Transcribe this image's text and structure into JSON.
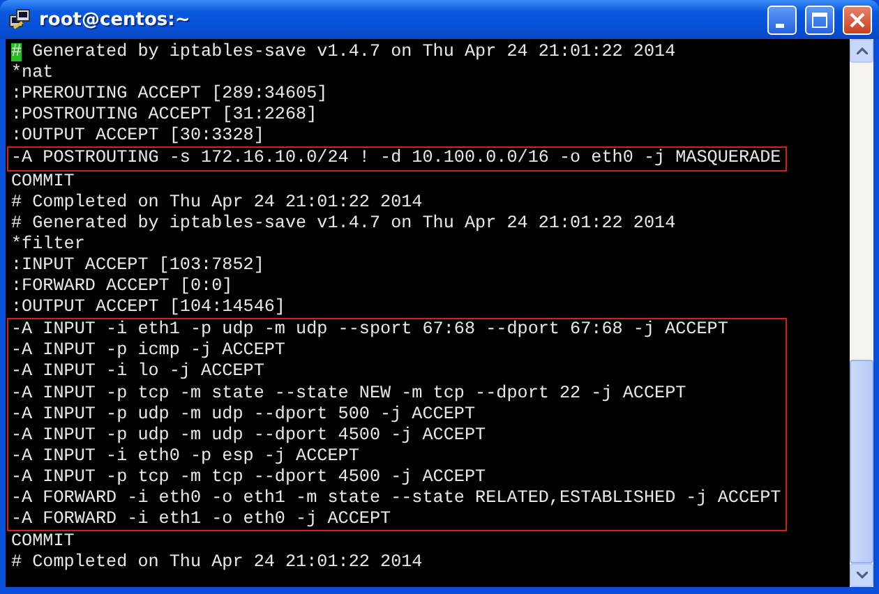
{
  "window": {
    "title": "root@centos:~"
  },
  "terminal": {
    "blocks": [
      {
        "highlighted": false,
        "lines": [
          {
            "text": "# Generated by iptables-save v1.4.7 on Thu Apr 24 21:01:22 2014",
            "cursor": true
          },
          {
            "text": "*nat",
            "cursor": false
          },
          {
            "text": ":PREROUTING ACCEPT [289:34605]",
            "cursor": false
          },
          {
            "text": ":POSTROUTING ACCEPT [31:2268]",
            "cursor": false
          },
          {
            "text": ":OUTPUT ACCEPT [30:3328]",
            "cursor": false
          }
        ]
      },
      {
        "highlighted": true,
        "lines": [
          {
            "text": "-A POSTROUTING -s 172.16.10.0/24 ! -d 10.100.0.0/16 -o eth0 -j MASQUERADE",
            "cursor": false
          }
        ]
      },
      {
        "highlighted": false,
        "lines": [
          {
            "text": "COMMIT",
            "cursor": false
          },
          {
            "text": "# Completed on Thu Apr 24 21:01:22 2014",
            "cursor": false
          },
          {
            "text": "# Generated by iptables-save v1.4.7 on Thu Apr 24 21:01:22 2014",
            "cursor": false
          },
          {
            "text": "*filter",
            "cursor": false
          },
          {
            "text": ":INPUT ACCEPT [103:7852]",
            "cursor": false
          },
          {
            "text": ":FORWARD ACCEPT [0:0]",
            "cursor": false
          },
          {
            "text": ":OUTPUT ACCEPT [104:14546]",
            "cursor": false
          }
        ]
      },
      {
        "highlighted": true,
        "lines": [
          {
            "text": "-A INPUT -i eth1 -p udp -m udp --sport 67:68 --dport 67:68 -j ACCEPT",
            "cursor": false
          },
          {
            "text": "-A INPUT -p icmp -j ACCEPT",
            "cursor": false
          },
          {
            "text": "-A INPUT -i lo -j ACCEPT",
            "cursor": false
          },
          {
            "text": "-A INPUT -p tcp -m state --state NEW -m tcp --dport 22 -j ACCEPT",
            "cursor": false
          },
          {
            "text": "-A INPUT -p udp -m udp --dport 500 -j ACCEPT",
            "cursor": false
          },
          {
            "text": "-A INPUT -p udp -m udp --dport 4500 -j ACCEPT",
            "cursor": false
          },
          {
            "text": "-A INPUT -i eth0 -p esp -j ACCEPT",
            "cursor": false
          },
          {
            "text": "-A INPUT -p tcp -m tcp --dport 4500 -j ACCEPT",
            "cursor": false
          },
          {
            "text": "-A FORWARD -i eth0 -o eth1 -m state --state RELATED,ESTABLISHED -j ACCEPT",
            "cursor": false
          },
          {
            "text": "-A FORWARD -i eth1 -o eth0 -j ACCEPT",
            "cursor": false
          }
        ]
      },
      {
        "highlighted": false,
        "lines": [
          {
            "text": "COMMIT",
            "cursor": false
          },
          {
            "text": "# Completed on Thu Apr 24 21:01:22 2014",
            "cursor": false
          }
        ]
      }
    ]
  }
}
